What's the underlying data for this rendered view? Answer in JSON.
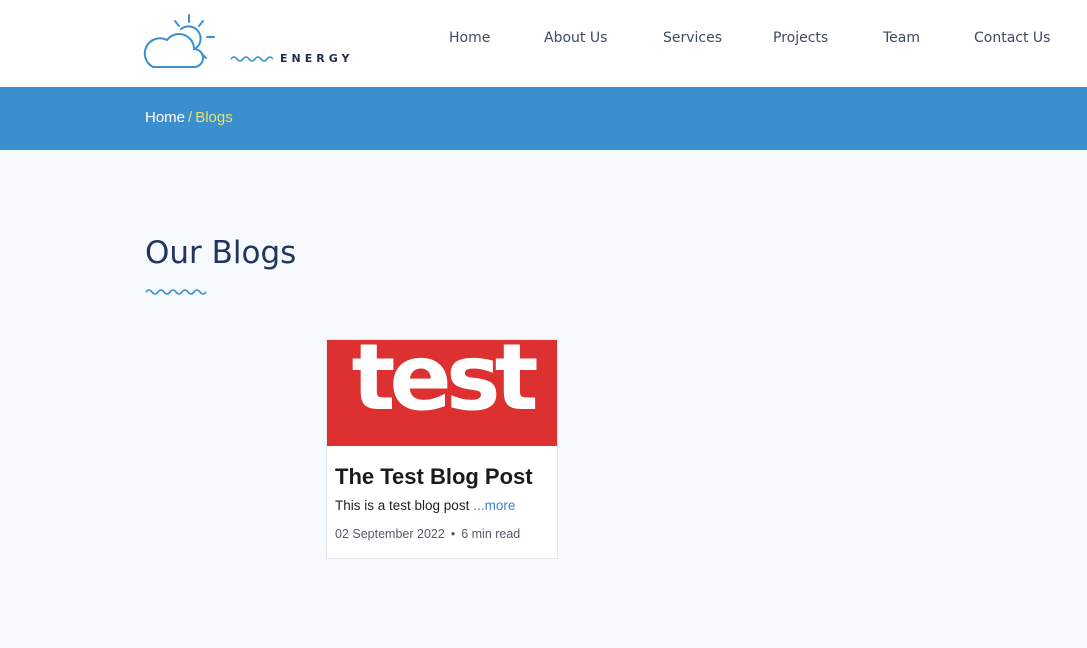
{
  "header": {
    "logo_word": "ENERGY",
    "nav": [
      {
        "label": "Home"
      },
      {
        "label": "About Us"
      },
      {
        "label": "Services"
      },
      {
        "label": "Projects"
      },
      {
        "label": "Team"
      },
      {
        "label": "Contact Us"
      }
    ]
  },
  "breadcrumb": {
    "home": "Home",
    "separator": "/",
    "current": "Blogs"
  },
  "main": {
    "title": "Our Blogs",
    "posts": [
      {
        "image_text": "test",
        "title": "The Test Blog Post",
        "excerpt": "This is a test blog post",
        "more_label": "...more",
        "date": "02 September 2022",
        "meta_separator": "•",
        "read_time": "6 min read"
      }
    ]
  },
  "colors": {
    "brand_blue": "#3c8fcf",
    "accent_yellow": "#e8e26e",
    "title_navy": "#22345f",
    "card_image_red": "#dd3030",
    "link_blue": "#3b82d6"
  },
  "icons": {
    "logo": "sun-cloud-icon",
    "title_underline": "wave-icon"
  }
}
